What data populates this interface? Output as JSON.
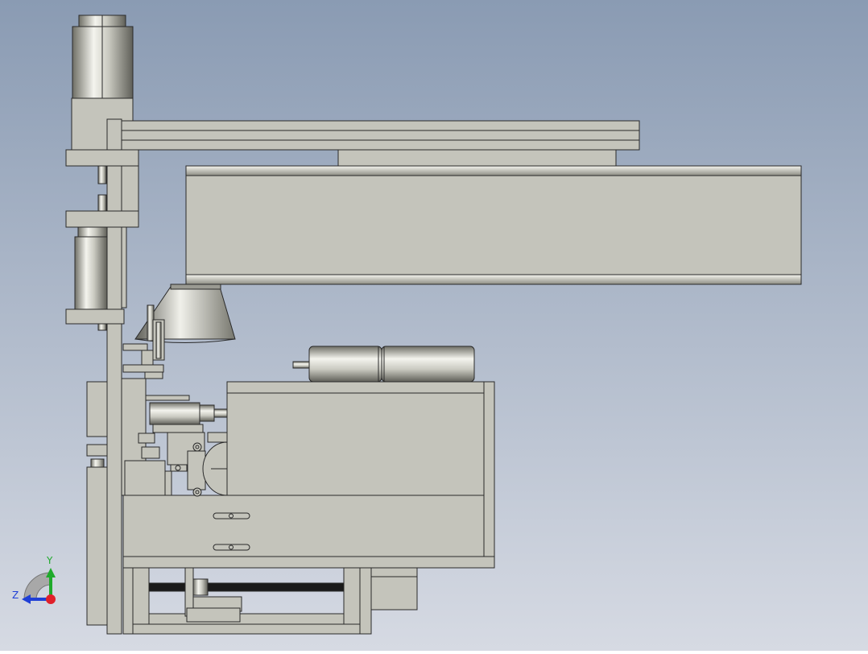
{
  "viewport": {
    "background_top": "#8a9bb3",
    "background_bottom": "#d6dae3"
  },
  "model": {
    "body_fill": "#c4c4bb",
    "edge_color": "#2a2a2a",
    "shaft_color": "#1a1a1a",
    "highlight": "#f2f2ec",
    "shade": "#7d7d74"
  },
  "triad": {
    "y_label": "Y",
    "z_label": "Z",
    "y_color": "#1faa2b",
    "z_color": "#1f3fd6",
    "x_color": "#e0202a"
  }
}
